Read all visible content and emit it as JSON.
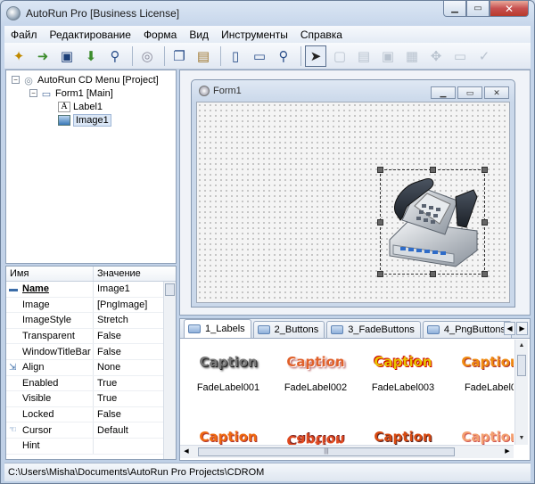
{
  "window": {
    "title": "AutoRun Pro [Business License]"
  },
  "menu": [
    "Файл",
    "Редактирование",
    "Форма",
    "Вид",
    "Инструменты",
    "Справка"
  ],
  "toolbar": {
    "icons": [
      "wizard-icon",
      "export-icon",
      "save-icon",
      "import-icon",
      "find-icon",
      "cd-icon",
      "copy-icon",
      "paste-icon",
      "new-form-icon",
      "form-icon",
      "preview-icon",
      "pointer-icon",
      "panel-icon",
      "label-tool-icon",
      "image-tool-icon",
      "grid-icon",
      "move-icon",
      "ok-button-icon",
      "check-icon"
    ]
  },
  "tree": {
    "root": "AutoRun CD Menu [Project]",
    "form": "Form1 [Main]",
    "label": "Label1",
    "image": "Image1"
  },
  "properties": {
    "header_name": "Имя",
    "header_value": "Значение",
    "rows": [
      {
        "name": "Name",
        "value": "Image1"
      },
      {
        "name": "Image",
        "value": "[PngImage]"
      },
      {
        "name": "ImageStyle",
        "value": "Stretch"
      },
      {
        "name": "Transparent",
        "value": "False"
      },
      {
        "name": "WindowTitleBar",
        "value": "False"
      },
      {
        "name": "Align",
        "value": "None"
      },
      {
        "name": "Enabled",
        "value": "True"
      },
      {
        "name": "Visible",
        "value": "True"
      },
      {
        "name": "Locked",
        "value": "False"
      },
      {
        "name": "Cursor",
        "value": "Default"
      },
      {
        "name": "Hint",
        "value": ""
      }
    ]
  },
  "designer": {
    "form_title": "Form1"
  },
  "tabs": [
    {
      "label": "1_Labels"
    },
    {
      "label": "2_Buttons"
    },
    {
      "label": "3_FadeButtons"
    },
    {
      "label": "4_PngButtons"
    }
  ],
  "gallery": {
    "caption_text": "Caption",
    "row1": [
      "FadeLabel001",
      "FadeLabel002",
      "FadeLabel003",
      "FadeLabel0"
    ],
    "colors": {
      "gray": "#7a7a7a",
      "orange_red": "#e0602a",
      "yellow": "#e8c400",
      "orange": "#f08a10"
    }
  },
  "status": {
    "path": "C:\\Users\\Misha\\Documents\\AutoRun Pro Projects\\CDROM"
  }
}
